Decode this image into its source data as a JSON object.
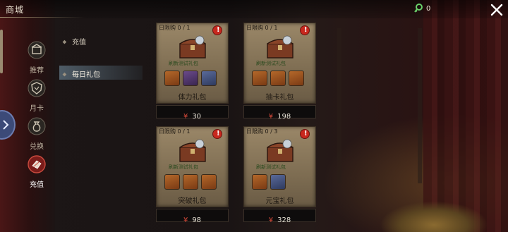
{
  "header": {
    "title": "商城",
    "currency_amount": "0"
  },
  "nav": [
    {
      "label": "推荐",
      "icon": "shop-counter-icon"
    },
    {
      "label": "月卡",
      "icon": "monthly-card-shield-icon"
    },
    {
      "label": "兑换",
      "icon": "money-bag-icon"
    },
    {
      "label": "充值",
      "icon": "gift-pouch-icon"
    }
  ],
  "submenu": [
    {
      "label": "充值"
    },
    {
      "label": "每日礼包"
    }
  ],
  "products": [
    {
      "limit": "日限购 0 / 1",
      "tag": "刷新测试礼包",
      "name": "体力礼包",
      "currency_symbol": "¥",
      "price": "30",
      "items": [
        "ingot-icon",
        "stamina-wing-icon",
        "coin-icon"
      ]
    },
    {
      "limit": "日限购 0 / 1",
      "tag": "刷新测试礼包",
      "name": "抽卡礼包",
      "currency_symbol": "¥",
      "price": "198",
      "items": [
        "ingot-icon",
        "draw-card-icon",
        "draw-card-icon"
      ]
    },
    {
      "limit": "日限购 0 / 1",
      "tag": "刷新测试礼包",
      "name": "突破礼包",
      "currency_symbol": "¥",
      "price": "98",
      "items": [
        "ingot-icon",
        "scroll-icon",
        "breakthrough-icon"
      ]
    },
    {
      "limit": "日限购 0 / 3",
      "tag": "刷新测试礼包",
      "name": "元宝礼包",
      "currency_symbol": "¥",
      "price": "328",
      "items": [
        "ingot-icon",
        "coin-icon"
      ]
    }
  ],
  "colors": {
    "accent_red": "#c8281e",
    "price_red": "#d84a3a",
    "nav_expand_blue": "#3c4a78"
  }
}
